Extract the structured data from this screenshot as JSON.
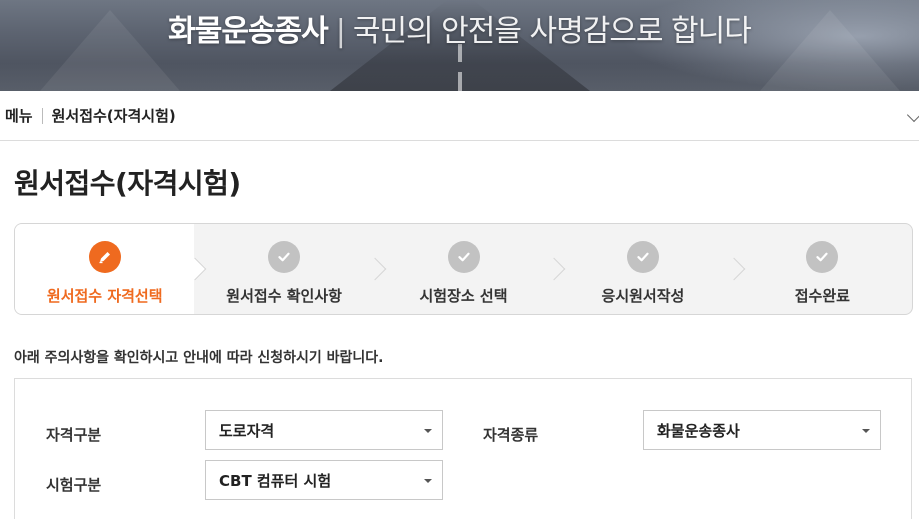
{
  "banner": {
    "brand": "화물운송종사",
    "separator": "|",
    "slogan": "국민의 안전을 사명감으로 합니다"
  },
  "breadcrumb": {
    "menu_label": "메뉴",
    "current": "원서접수(자격시험)"
  },
  "page_title": "원서접수(자격시험)",
  "steps": [
    {
      "label": "원서접수 자격선택",
      "icon": "pencil-icon",
      "active": true
    },
    {
      "label": "원서접수 확인사항",
      "icon": "check-icon",
      "active": false
    },
    {
      "label": "시험장소 선택",
      "icon": "check-icon",
      "active": false
    },
    {
      "label": "응시원서작성",
      "icon": "check-icon",
      "active": false
    },
    {
      "label": "접수완료",
      "icon": "check-icon",
      "active": false
    }
  ],
  "notice": "아래 주의사항을 확인하시고 안내에 따라 신청하시기 바랍니다.",
  "form": {
    "qualification_type_label": "자격구분",
    "qualification_type_value": "도로자격",
    "qualification_kind_label": "자격종류",
    "qualification_kind_value": "화물운송종사",
    "exam_type_label": "시험구분",
    "exam_type_value": "CBT 컴퓨터 시험"
  },
  "colors": {
    "accent": "#ef6a1f",
    "inactive_step_icon": "#c2c2c2",
    "inactive_step_bg": "#f3f3f3"
  }
}
